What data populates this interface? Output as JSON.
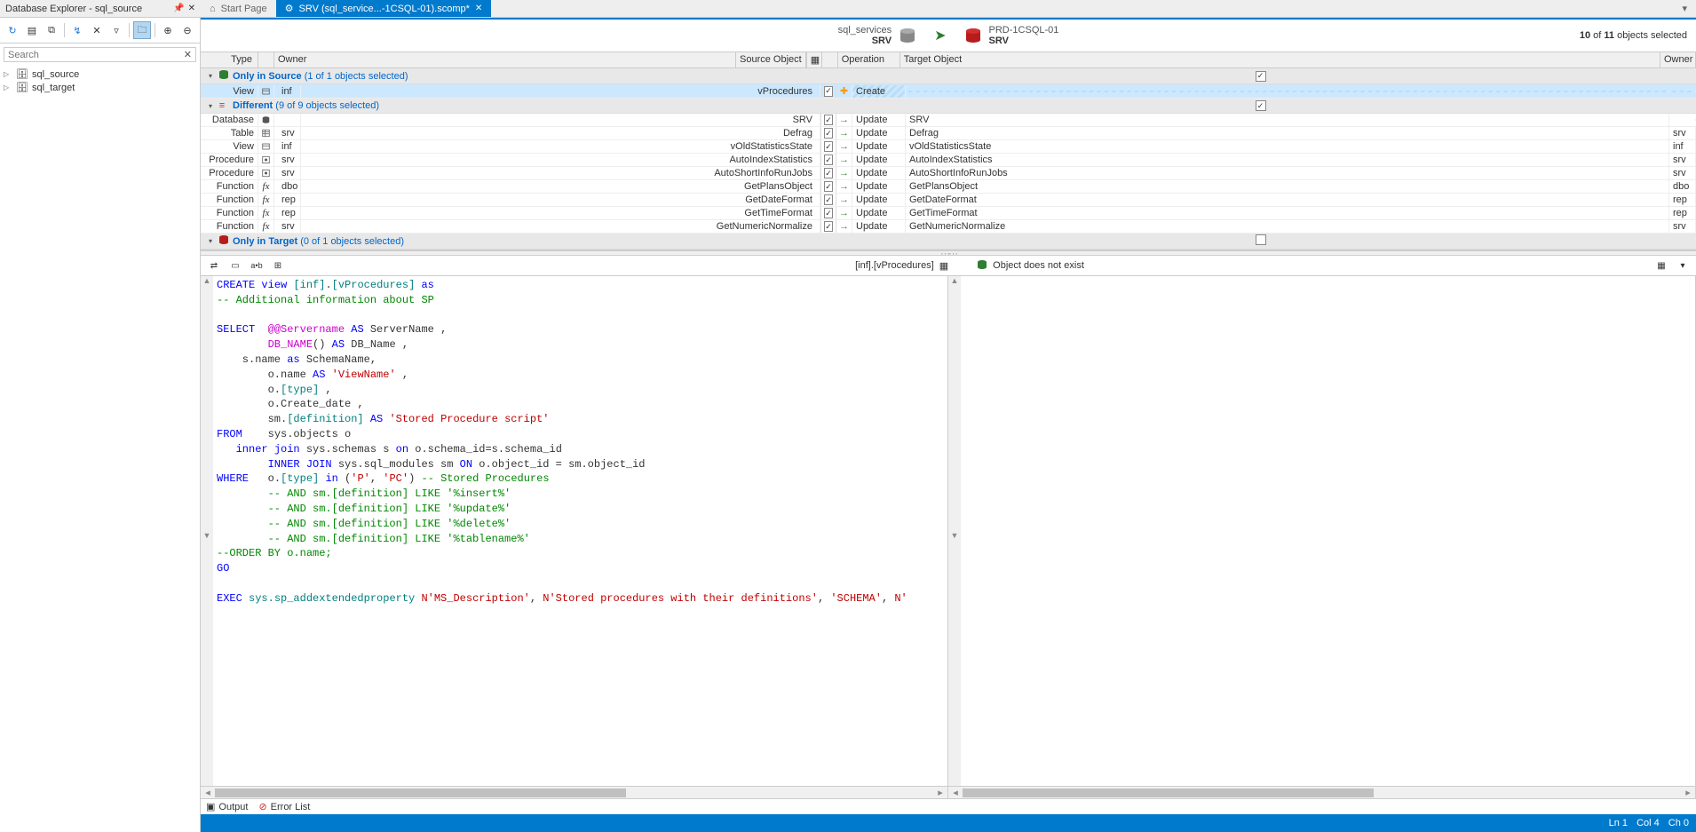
{
  "panel_title": "Database Explorer - sql_source",
  "tabs": {
    "start": "Start Page",
    "compare": "SRV (sql_service...-1CSQL-01).scomp*"
  },
  "search": {
    "placeholder": "Search"
  },
  "tree": {
    "items": [
      {
        "label": "sql_source"
      },
      {
        "label": "sql_target"
      }
    ]
  },
  "compare": {
    "source": {
      "name": "sql_services",
      "srv": "SRV"
    },
    "target": {
      "name": "PRD-1CSQL-01",
      "srv": "SRV"
    },
    "selected_count": {
      "n": "10",
      "of": "of",
      "total": "11",
      "suffix": "objects selected"
    }
  },
  "grid_headers": {
    "type": "Type",
    "owner": "Owner",
    "source_object": "Source Object",
    "operation": "Operation",
    "target_object": "Target Object",
    "owner2": "Owner"
  },
  "groups": {
    "only_source": {
      "title": "Only in Source",
      "sel": "(1 of 1 objects selected)"
    },
    "different": {
      "title": "Different",
      "sel": "(9 of 9 objects selected)"
    },
    "only_target": {
      "title": "Only in Target",
      "sel": "(0 of 1 objects selected)"
    }
  },
  "rows_source_only": [
    {
      "type": "View",
      "owner": "inf",
      "src": "vProcedures",
      "op": "Create",
      "target": "",
      "owner2": ""
    }
  ],
  "rows_diff": [
    {
      "type": "Database",
      "owner": "",
      "src": "SRV",
      "op": "Update",
      "target": "SRV",
      "owner2": ""
    },
    {
      "type": "Table",
      "owner": "srv",
      "src": "Defrag",
      "op": "Update",
      "target": "Defrag",
      "owner2": "srv"
    },
    {
      "type": "View",
      "owner": "inf",
      "src": "vOldStatisticsState",
      "op": "Update",
      "target": "vOldStatisticsState",
      "owner2": "inf"
    },
    {
      "type": "Procedure",
      "owner": "srv",
      "src": "AutoIndexStatistics",
      "op": "Update",
      "target": "AutoIndexStatistics",
      "owner2": "srv"
    },
    {
      "type": "Procedure",
      "owner": "srv",
      "src": "AutoShortInfoRunJobs",
      "op": "Update",
      "target": "AutoShortInfoRunJobs",
      "owner2": "srv"
    },
    {
      "type": "Function",
      "owner": "dbo",
      "src": "GetPlansObject",
      "op": "Update",
      "target": "GetPlansObject",
      "owner2": "dbo"
    },
    {
      "type": "Function",
      "owner": "rep",
      "src": "GetDateFormat",
      "op": "Update",
      "target": "GetDateFormat",
      "owner2": "rep"
    },
    {
      "type": "Function",
      "owner": "rep",
      "src": "GetTimeFormat",
      "op": "Update",
      "target": "GetTimeFormat",
      "owner2": "rep"
    },
    {
      "type": "Function",
      "owner": "srv",
      "src": "GetNumericNormalize",
      "op": "Update",
      "target": "GetNumericNormalize",
      "owner2": "srv"
    }
  ],
  "detail": {
    "left_label": "[inf].[vProcedures]",
    "right_label": "Object does not exist"
  },
  "bottom": {
    "output": "Output",
    "errors": "Error List"
  },
  "status": {
    "ln": "Ln 1",
    "col": "Col 4",
    "ch": "Ch 0"
  }
}
